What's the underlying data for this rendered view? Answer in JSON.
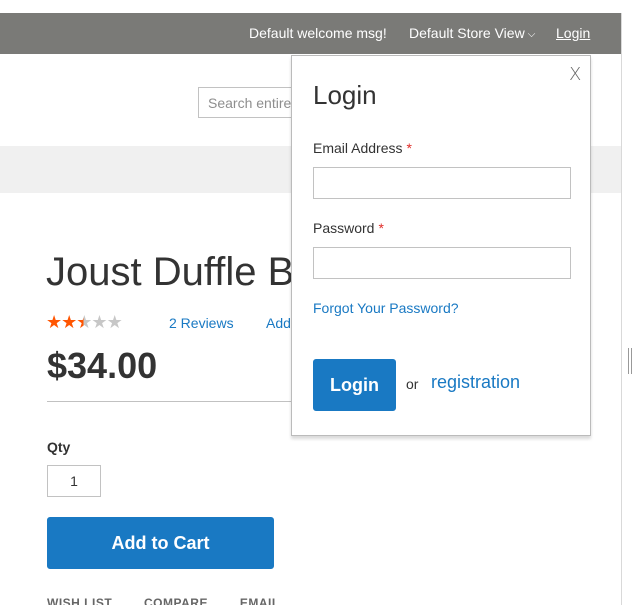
{
  "topbar": {
    "welcome": "Default welcome msg!",
    "store_view": "Default Store View",
    "login": "Login"
  },
  "header": {
    "search_placeholder": "Search entire store here..."
  },
  "product": {
    "title": "Joust Duffle Bag",
    "rating_stars": 2.5,
    "rating_max": 5,
    "reviews": "2 Reviews",
    "add_review": "Add Your Review",
    "price": "$34.00",
    "qty_label": "Qty",
    "qty_value": "1",
    "add_to_cart": "Add to Cart",
    "actions": [
      "WISH LIST",
      "COMPARE",
      "EMAIL"
    ]
  },
  "login_popup": {
    "close": "X",
    "title": "Login",
    "email_label": "Email Address",
    "password_label": "Password",
    "required_marker": "*",
    "forgot": "Forgot Your Password?",
    "login_button": "Login",
    "or": "or",
    "registration": "registration"
  },
  "colors": {
    "topbar_bg": "#7a7a77",
    "accent": "#1979c3",
    "star_on": "#ff5501",
    "star_off": "#c7c7c7",
    "required": "#e02b27"
  }
}
